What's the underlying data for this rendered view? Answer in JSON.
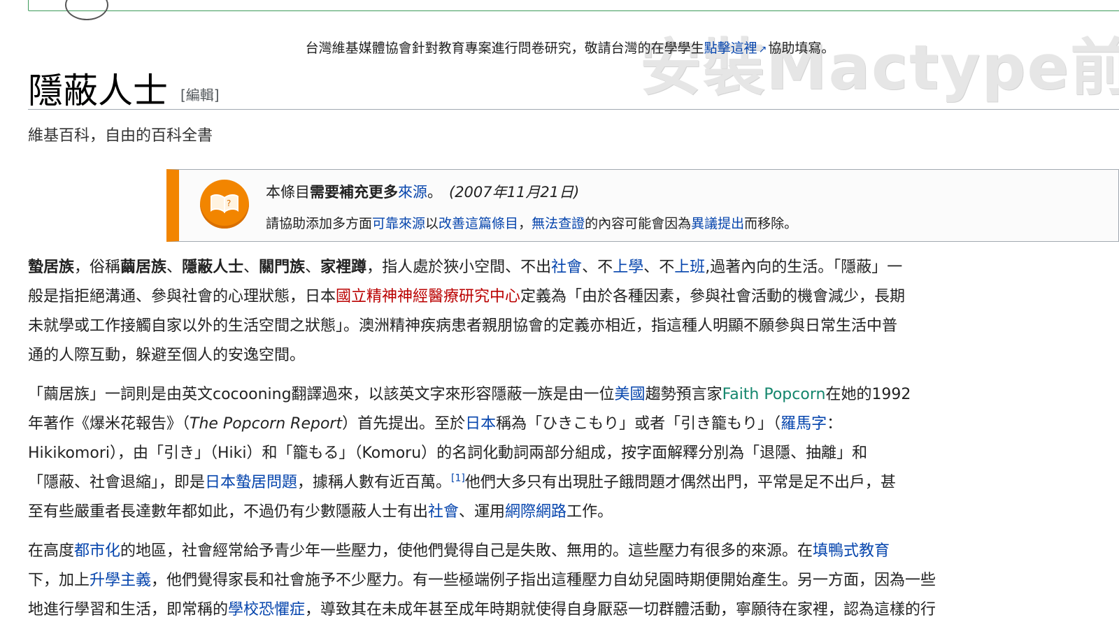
{
  "banner": {},
  "sitenotice": {
    "text_before": "台灣維基媒體協會針對教育專案進行問卷研究，敬請台灣的在學學生",
    "link_text": "點擊這裡",
    "text_after": "協助填寫。"
  },
  "watermark": {
    "text": "安裝Mactype前"
  },
  "heading": {
    "title": "隱蔽人士",
    "edit_label": "[編輯]"
  },
  "tagline": "維基百科，自由的百科全書",
  "ambox": {
    "line1": {
      "prefix": "本條目",
      "bold": "需要補充更多",
      "link": "來源",
      "suffix": "。",
      "date": "(2007年11月21日)"
    },
    "line2": {
      "t1": "請協助添加多方面",
      "l1": "可靠來源",
      "t2": "以",
      "l2": "改善這篇條目",
      "t3": "，",
      "l3": "無法查證",
      "t4": "的內容可能會因為",
      "l4": "異議提出",
      "t5": "而移除。"
    }
  },
  "paragraphs": {
    "p1": {
      "l1": {
        "b1": "蟄居族",
        "t1": "，俗稱",
        "b2": "繭居族",
        "t2": "、",
        "b3": "隱蔽人士",
        "t3": "、",
        "b4": "關門族",
        "t4": "、",
        "b5": "家裡蹲",
        "t5": "，指人處於狹小空間、不出",
        "a1": "社會",
        "t6": "、不",
        "a2": "上學",
        "t7": "、不",
        "a3": "上班",
        "t8": ",過著內向的生活。「隱蔽」一"
      },
      "l2": {
        "t1": "般是指拒絕溝通、參與社會的心理狀態，日本",
        "r1": "國立精神神經醫療研究中心",
        "t2": "定義為「由於各種因素，參與社會活動的機會減少，長期"
      },
      "l3": "未就學或工作接觸自家以外的生活空間之狀態」。澳洲精神疾病患者親朋協會的定義亦相近，指這種人明顯不願參與日常生活中普",
      "l4": "通的人際互動，躲避至個人的安逸空間。"
    },
    "p2": {
      "l1": {
        "t1": "「繭居族」一詞則是由英文cocooning翻譯過來，以該英文字來形容隱蔽一族是由一位",
        "a1": "美國",
        "t2": "趨勢預言家",
        "g1": "Faith Popcorn",
        "t3": "在她的1992"
      },
      "l2": {
        "t1": "年著作《爆米花報告》（",
        "i1": "The Popcorn Report",
        "t2": "）首先提出。至於",
        "a1": "日本",
        "t3": "稱為「ひきこもり」或者「引き籠もり」（",
        "a2": "羅馬字",
        "t4": "："
      },
      "l3": "Hikikomori），由「引き」（Hiki）和「籠もる」（Komoru）的名詞化動詞兩部分組成，按字面解釋分別為「退隱、抽離」和",
      "l4": {
        "t1": "「隱蔽、社會退縮」，即是",
        "a1": "日本蟄居問題",
        "t2": "，據稱人數有近百萬。",
        "sup": "[1]",
        "t3": "他們大多只有出現肚子餓問題才偶然出門，平常是足不出戶，甚"
      },
      "l5": {
        "t1": "至有些嚴重者長達數年都如此，不過仍有少數隱蔽人士有出",
        "a1": "社會",
        "t2": "、運用",
        "a2": "網際網路",
        "t3": "工作。"
      }
    },
    "p3": {
      "l1": {
        "t1": "在高度",
        "a1": "都市化",
        "t2": "的地區，社會經常給予青少年一些壓力，使他們覺得自己是失敗、無用的。這些壓力有很多的來源。在",
        "a2": "填鴨式教育"
      },
      "l2": {
        "t1": "下，加上",
        "a1": "升學主義",
        "t2": "，他們覺得家長和社會施予不少壓力。有一些極端例子指出這種壓力自幼兒園時期便開始產生。另一方面，因為一些"
      },
      "l3": {
        "t1": "地進行學習和生活，即常稱的",
        "a1": "學校恐懼症",
        "t2": "，導致其在未成年甚至成年時期就使得自身厭惡一切群體活動，寧願待在家裡，認為這樣的行"
      }
    }
  },
  "colors": {
    "link": "#0645ad",
    "redlink": "#ba0000",
    "external_green": "#14866d",
    "ambox_accent": "#f28500",
    "banner_border": "#3d9a5b"
  },
  "icons": [
    "external-link-icon",
    "open-book-icon"
  ]
}
